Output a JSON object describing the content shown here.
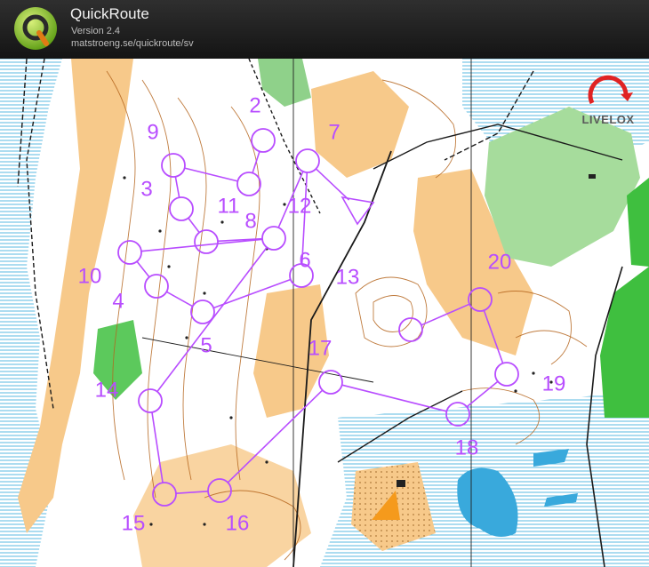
{
  "app": {
    "title": "QuickRoute",
    "version": "Version 2.4",
    "url": "matstroeng.se/quickroute/sv"
  },
  "watermark": {
    "text": "LIVELOX"
  },
  "colors": {
    "course": "#b84dff",
    "forest": "#ffffff",
    "open_land": "#f7c98a",
    "green": "#8fd18a",
    "dark_green": "#3fbf3f",
    "water": "#39a9dc",
    "marsh": "#7ac6e6",
    "contour": "#b5651d",
    "header_bg": "#1c1c1c"
  },
  "controls": [
    {
      "label": "2"
    },
    {
      "label": "3"
    },
    {
      "label": "4"
    },
    {
      "label": "5"
    },
    {
      "label": "6"
    },
    {
      "label": "7"
    },
    {
      "label": "8"
    },
    {
      "label": "9"
    },
    {
      "label": "10"
    },
    {
      "label": "11"
    },
    {
      "label": "12"
    },
    {
      "label": "13"
    },
    {
      "label": "14"
    },
    {
      "label": "15"
    },
    {
      "label": "16"
    },
    {
      "label": "17"
    },
    {
      "label": "18"
    },
    {
      "label": "19"
    },
    {
      "label": "20"
    }
  ]
}
